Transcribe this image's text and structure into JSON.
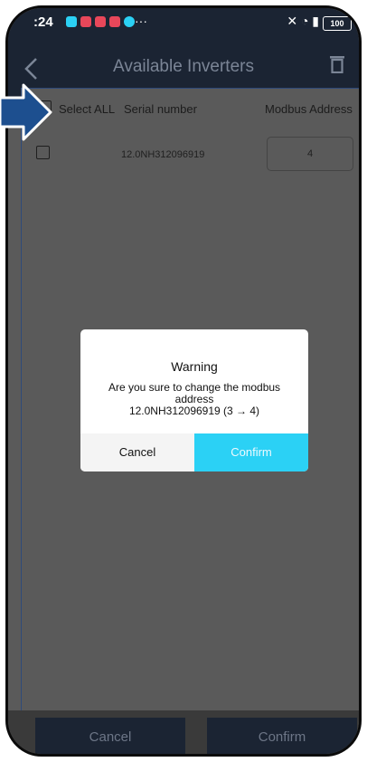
{
  "status_bar": {
    "time": ":24",
    "more_indicator": "···",
    "battery": "100"
  },
  "nav": {
    "title": "Available Inverters"
  },
  "table": {
    "select_all_label": "Select ALL",
    "serial_header": "Serial number",
    "address_header": "Modbus Address",
    "rows": [
      {
        "serial": "12.0NH312096919",
        "address": "4"
      }
    ]
  },
  "dialog": {
    "title": "Warning",
    "message_line1": "Are you sure to change the modbus",
    "message_line2": "address",
    "message_line3": "12.0NH312096919 (3 → 4)",
    "cancel_label": "Cancel",
    "confirm_label": "Confirm"
  },
  "bottom_bar": {
    "cancel_label": "Cancel",
    "confirm_label": "Confirm"
  },
  "colors": {
    "nav_bg": "#1b2433",
    "overlay": "#5a5a5a",
    "confirm_accent": "#2bd1f5",
    "arrow": "#1d4f8f"
  }
}
